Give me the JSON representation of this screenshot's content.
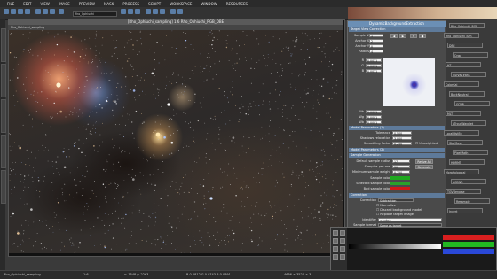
{
  "menubar": {
    "items": [
      "FILE",
      "EDIT",
      "VIEW",
      "IMAGE",
      "PREVIEW",
      "MASK",
      "PROCESS",
      "SCRIPT",
      "WORKSPACE",
      "WINDOW",
      "RESOURCES"
    ]
  },
  "toolbar": {
    "selected_view": "Rho_Ophiuchi"
  },
  "image_window": {
    "title": "[Rho_Ophiuchi_sampling] 1:6 Rho_Ophiuchi_RGB_DBE",
    "tab": "Rho_Ophiuchi_sampling"
  },
  "dbe_panel": {
    "title": "DynamicBackgroundExtraction",
    "sections": {
      "target": "Target View Correction",
      "model": "Model Parameters (1)",
      "model2": "Model Parameters (2)",
      "sample_gen": "Sample Generation",
      "correction": "Correction"
    },
    "sample_rows": [
      {
        "label": "Sample #",
        "value": "1"
      },
      {
        "label": "Anchor X",
        "value": "2"
      },
      {
        "label": "Anchor Y",
        "value": "0"
      },
      {
        "label": "Radius",
        "value": "4"
      }
    ],
    "channel_rows": [
      {
        "label": "R",
        "value": "0.0031"
      },
      {
        "label": "G",
        "value": "0.0031"
      },
      {
        "label": "B",
        "value": "0.0031"
      }
    ],
    "wt_rows": [
      {
        "label": "Wr",
        "value": "0.0001"
      },
      {
        "label": "Wg",
        "value": "0.0001"
      },
      {
        "label": "Wb",
        "value": "0.0001"
      }
    ],
    "tolerance": {
      "label": "Tolerance",
      "value": "0.500"
    },
    "shadows": {
      "label": "Shadows relaxation",
      "value": "3.000"
    },
    "smoothing": {
      "label": "Smoothing factor",
      "value": "0.250"
    },
    "unweighted_label": "Unweighted",
    "defaults_rows": [
      {
        "label": "Default sample radius",
        "value": "17"
      },
      {
        "label": "Samples per row",
        "value": "30"
      },
      {
        "label": "Minimum sample weight",
        "value": "0.750"
      },
      {
        "label": "Sample color",
        "value": ""
      },
      {
        "label": "Selected sample color",
        "value": ""
      },
      {
        "label": "Bad sample color",
        "value": ""
      }
    ],
    "resize_btn": "Resize All",
    "generate_btn": "Generate",
    "correction_label": "Correction",
    "correction_value": "Subtraction",
    "checks": [
      "Normalize",
      "Discard background model",
      "Replace target image"
    ],
    "identifier_label": "Identifier",
    "identifier_value": "<Auto>",
    "sample_format_label": "Sample format",
    "sample_format_value": "Same as target"
  },
  "right_icons": [
    "Rho_Ophiuchi_RGB",
    "Rho_Ophiuchi_lum",
    "DBE",
    "Crop",
    "HT",
    "CurvesTrans",
    "ColorCal",
    "BackNeutral",
    "SCNR",
    "MLT",
    "ATrousWavelet",
    "LocalHistEq",
    "StarMask",
    "PixelMath",
    "HDRMT",
    "Morphological",
    "ACDNR",
    "TGVDenoise",
    "Resample",
    "Invert"
  ],
  "status": {
    "view": "Rho_Ophiuchi_sampling",
    "zoom": "1:6",
    "coords": "x: 1548  y: 2263",
    "rgb": "R 0.0812  G 0.0743  B 0.0691",
    "dims": "4656 × 3520 × 3"
  },
  "colors": {
    "sample": "#1fa81f",
    "selected": "#2aa02a",
    "bad": "#d01818",
    "accent": "#6b8fb5"
  }
}
